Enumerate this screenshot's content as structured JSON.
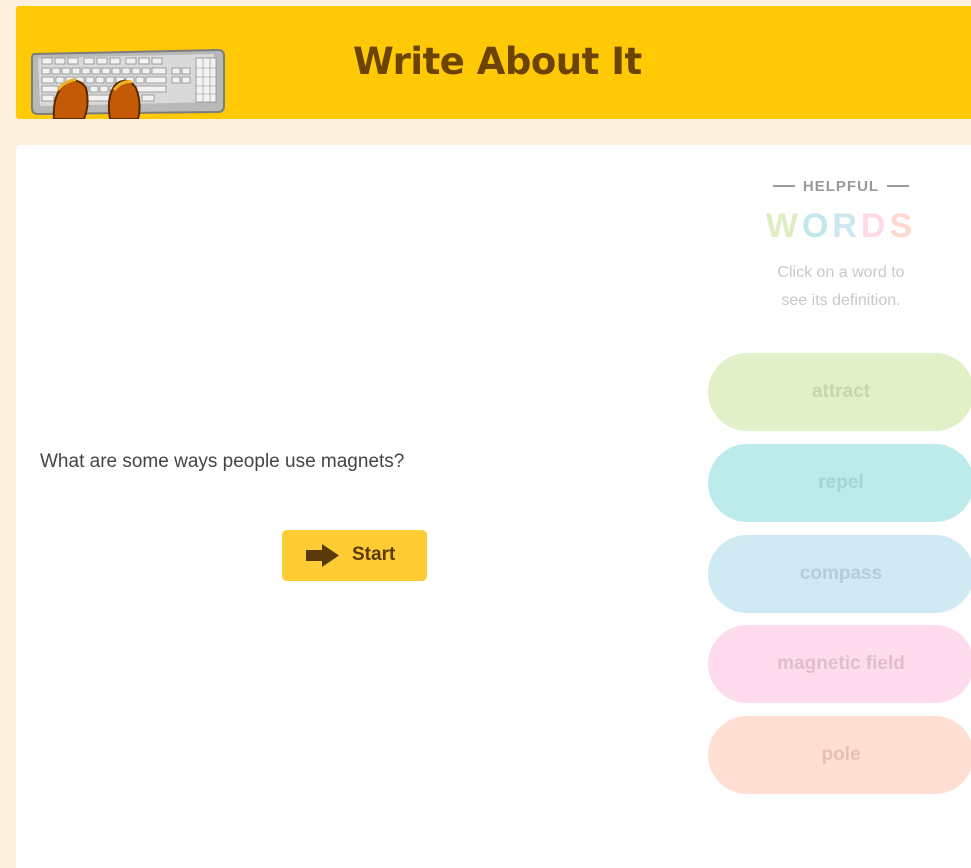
{
  "header": {
    "title": "Write About It"
  },
  "question": {
    "prompt": "What are some ways people use magnets?",
    "start_label": "Start"
  },
  "helpful_words": {
    "heading": "HELPFUL",
    "title_letters": [
      {
        "char": "W",
        "color": "#ddeec0"
      },
      {
        "char": "O",
        "color": "#bfe9ec"
      },
      {
        "char": "R",
        "color": "#cce7f1"
      },
      {
        "char": "D",
        "color": "#ffd9e8"
      },
      {
        "char": "S",
        "color": "#ffd9cf"
      }
    ],
    "instructions_line1": "Click on a word to",
    "instructions_line2": "see its definition.",
    "words": [
      {
        "label": "attract",
        "bg": "#e1f0c6",
        "fg": "#c7d6b0"
      },
      {
        "label": "repel",
        "bg": "#bdebec",
        "fg": "#a4d4d6"
      },
      {
        "label": "compass",
        "bg": "#cfeaf3",
        "fg": "#b2ced8"
      },
      {
        "label": "magnetic field",
        "bg": "#ffdced",
        "fg": "#e1bdcd"
      },
      {
        "label": "pole",
        "bg": "#ffdfd4",
        "fg": "#e4c1b6"
      }
    ]
  },
  "colors": {
    "header_bg": "#ffca05",
    "title_color": "#6b4303",
    "start_bg": "#ffcc33",
    "page_bg": "#fbf1de"
  }
}
